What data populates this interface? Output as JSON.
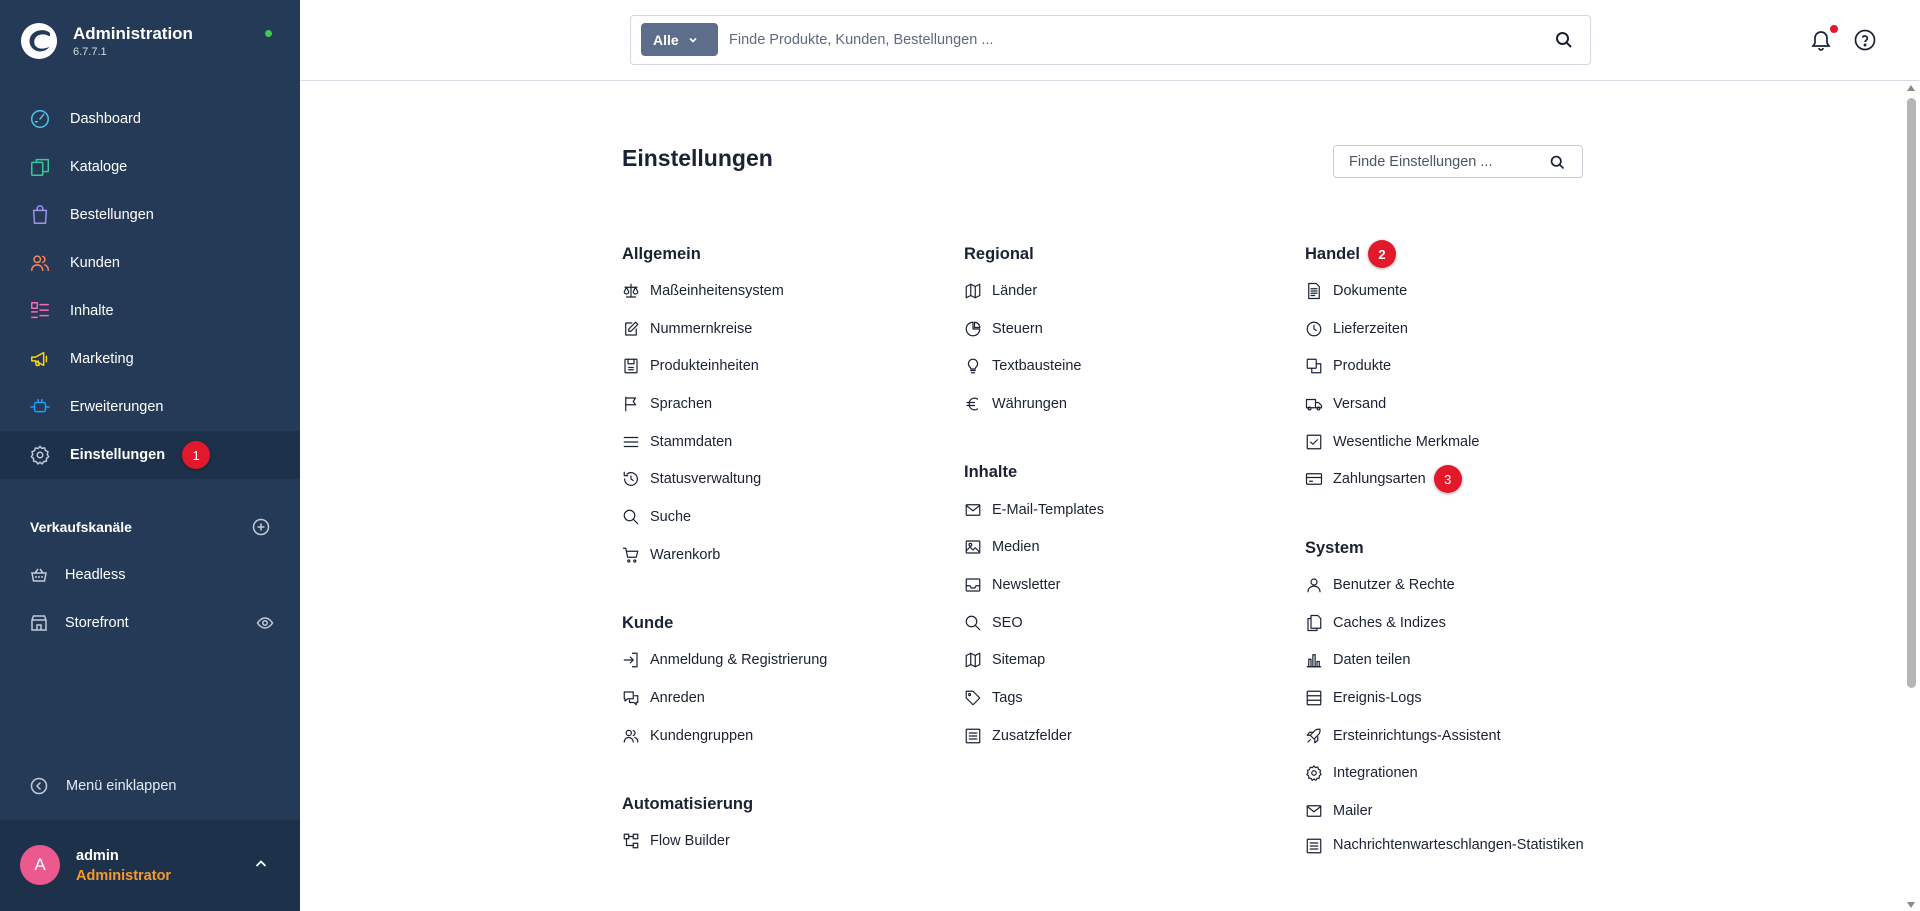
{
  "app": {
    "title": "Administration",
    "version": "6.7.7.1"
  },
  "sidebar": {
    "items": [
      {
        "label": "Dashboard",
        "icon": "gauge-icon",
        "color": "#52c5e8"
      },
      {
        "label": "Kataloge",
        "icon": "catalog-icon",
        "color": "#3bc89a"
      },
      {
        "label": "Bestellungen",
        "icon": "shopping-bag-icon",
        "color": "#a092f0"
      },
      {
        "label": "Kunden",
        "icon": "users-icon",
        "color": "#f88962"
      },
      {
        "label": "Inhalte",
        "icon": "content-icon",
        "color": "#ff68b4"
      },
      {
        "label": "Marketing",
        "icon": "megaphone-icon",
        "color": "#ffd700"
      },
      {
        "label": "Erweiterungen",
        "icon": "plugin-icon",
        "color": "#189eff"
      },
      {
        "label": "Einstellungen",
        "icon": "gear-icon",
        "color": "#c2cbd8",
        "badge": "1"
      }
    ],
    "sales_channels": {
      "title": "Verkaufskanäle",
      "items": [
        {
          "label": "Headless",
          "icon": "basket-icon"
        },
        {
          "label": "Storefront",
          "icon": "storefront-icon"
        }
      ]
    },
    "collapse_label": "Menü einklappen",
    "user": {
      "initial": "A",
      "name": "admin",
      "role": "Administrator"
    }
  },
  "topbar": {
    "search_type": "Alle",
    "search_placeholder": "Finde Produkte, Kunden, Bestellungen ..."
  },
  "page": {
    "title": "Einstellungen",
    "search_placeholder": "Finde Einstellungen ...",
    "columns": [
      [
        {
          "title": "Allgemein",
          "items": [
            {
              "label": "Maßeinheitensystem",
              "icon": "scale-icon"
            },
            {
              "label": "Nummernkreise",
              "icon": "edit-icon"
            },
            {
              "label": "Produkteinheiten",
              "icon": "unit-icon"
            },
            {
              "label": "Sprachen",
              "icon": "flag-icon"
            },
            {
              "label": "Stammdaten",
              "icon": "menu-icon"
            },
            {
              "label": "Statusverwaltung",
              "icon": "history-icon"
            },
            {
              "label": "Suche",
              "icon": "search-icon"
            },
            {
              "label": "Warenkorb",
              "icon": "cart-icon"
            }
          ]
        },
        {
          "title": "Kunde",
          "items": [
            {
              "label": "Anmeldung & Registrierung",
              "icon": "sign-in-icon"
            },
            {
              "label": "Anreden",
              "icon": "chat-icon"
            },
            {
              "label": "Kundengruppen",
              "icon": "users-icon"
            }
          ]
        },
        {
          "title": "Automatisierung",
          "items": [
            {
              "label": "Flow Builder",
              "icon": "flow-icon"
            }
          ]
        }
      ],
      [
        {
          "title": "Regional",
          "items": [
            {
              "label": "Länder",
              "icon": "map-icon"
            },
            {
              "label": "Steuern",
              "icon": "pie-chart-icon"
            },
            {
              "label": "Textbausteine",
              "icon": "lightbulb-icon"
            },
            {
              "label": "Währungen",
              "icon": "euro-icon"
            }
          ]
        },
        {
          "title": "Inhalte",
          "items": [
            {
              "label": "E-Mail-Templates",
              "icon": "envelope-icon"
            },
            {
              "label": "Medien",
              "icon": "image-icon"
            },
            {
              "label": "Newsletter",
              "icon": "inbox-icon"
            },
            {
              "label": "SEO",
              "icon": "search-icon"
            },
            {
              "label": "Sitemap",
              "icon": "map-icon"
            },
            {
              "label": "Tags",
              "icon": "tag-icon"
            },
            {
              "label": "Zusatzfelder",
              "icon": "list-icon"
            }
          ]
        }
      ],
      [
        {
          "title": "Handel",
          "badge": "2",
          "items": [
            {
              "label": "Dokumente",
              "icon": "document-icon"
            },
            {
              "label": "Lieferzeiten",
              "icon": "clock-icon"
            },
            {
              "label": "Produkte",
              "icon": "products-icon"
            },
            {
              "label": "Versand",
              "icon": "truck-icon"
            },
            {
              "label": "Wesentliche Merkmale",
              "icon": "checkbox-icon"
            },
            {
              "label": "Zahlungsarten",
              "icon": "credit-card-icon",
              "badge": "3"
            }
          ]
        },
        {
          "title": "System",
          "items": [
            {
              "label": "Benutzer & Rechte",
              "icon": "user-icon"
            },
            {
              "label": "Caches & Indizes",
              "icon": "files-icon"
            },
            {
              "label": "Daten teilen",
              "icon": "bar-chart-icon"
            },
            {
              "label": "Ereignis-Logs",
              "icon": "server-icon"
            },
            {
              "label": "Ersteinrichtungs-Assistent",
              "icon": "rocket-icon"
            },
            {
              "label": "Integrationen",
              "icon": "cog-icon"
            },
            {
              "label": "Mailer",
              "icon": "envelope-icon"
            },
            {
              "label": "Nachrichtenwarteschlangen-Statistiken",
              "icon": "list-icon",
              "wrap": true
            }
          ]
        }
      ]
    ]
  },
  "colors": {
    "sidebar_bg": "#253a56",
    "sidebar_active": "#1d314b",
    "badge": "#e1192a",
    "role": "#f79a2d",
    "avatar": "#ec5a8d"
  }
}
